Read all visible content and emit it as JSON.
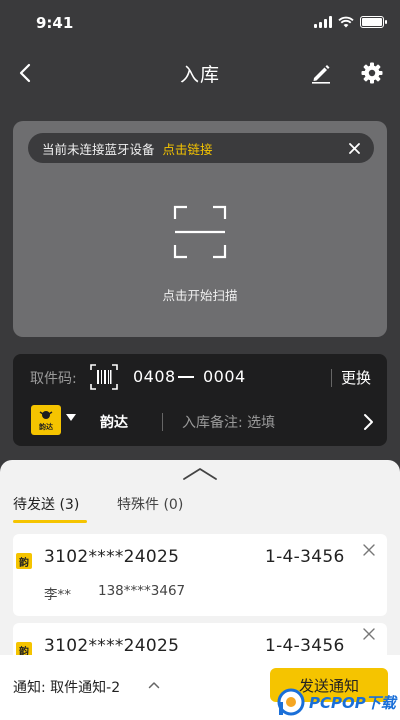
{
  "status_bar": {
    "time": "9:41"
  },
  "nav": {
    "title": "入库"
  },
  "bluetooth": {
    "message": "当前未连接蓝牙设备",
    "link": "点击链接"
  },
  "scan": {
    "label": "点击开始扫描"
  },
  "pickup": {
    "label": "取件码:",
    "code_part1": "0408",
    "code_part2": "0004",
    "change_label": "更换"
  },
  "courier": {
    "logo_text": "韵达",
    "name": "韵达",
    "remark_label": "入库备注: 选填"
  },
  "tabs": [
    {
      "label": "待发送 (3)",
      "active": true
    },
    {
      "label": "特殊件 (0)",
      "active": false
    }
  ],
  "items": [
    {
      "badge": "韵",
      "tracking": "3102****24025",
      "shelf": "1-4-3456",
      "name": "李**",
      "phone": "138****3467"
    },
    {
      "badge": "韵",
      "tracking": "3102****24025",
      "shelf": "1-4-3456",
      "name": "",
      "phone": ""
    }
  ],
  "footer": {
    "notify_label": "通知:  取件通知-2",
    "send_label": "发送通知"
  },
  "watermark": {
    "text": "PCPOP下载"
  },
  "colors": {
    "accent": "#f5c400",
    "dark": "#3a3a3c",
    "panel": "#1e1e1f"
  }
}
